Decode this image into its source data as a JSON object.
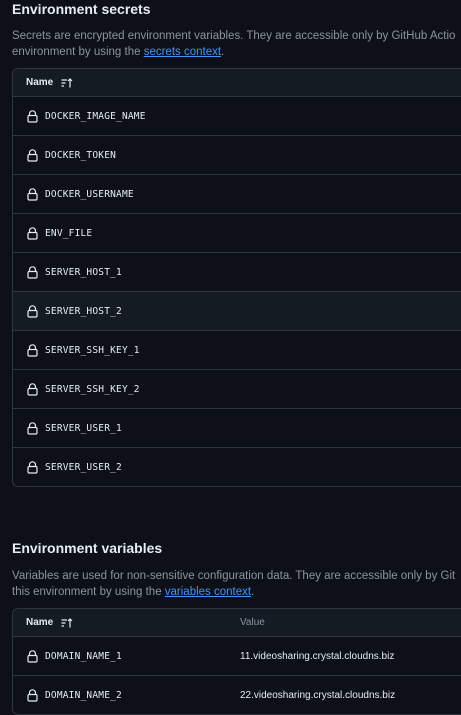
{
  "secrets": {
    "title": "Environment secrets",
    "desc_line1": "Secrets are encrypted environment variables. They are accessible only by GitHub Actio",
    "desc_line2_pre": "environment by using the ",
    "desc_link": "secrets context",
    "desc_line2_post": ".",
    "header_name": "Name",
    "rows": [
      "DOCKER_IMAGE_NAME",
      "DOCKER_TOKEN",
      "DOCKER_USERNAME",
      "ENV_FILE",
      "SERVER_HOST_1",
      "SERVER_HOST_2",
      "SERVER_SSH_KEY_1",
      "SERVER_SSH_KEY_2",
      "SERVER_USER_1",
      "SERVER_USER_2"
    ]
  },
  "variables": {
    "title": "Environment variables",
    "desc_line1": "Variables are used for non-sensitive configuration data. They are accessible only by Git",
    "desc_line2_pre": "this environment by using the ",
    "desc_link": "variables context",
    "desc_line2_post": ".",
    "header_name": "Name",
    "header_value": "Value",
    "rows": [
      {
        "name": "DOMAIN_NAME_1",
        "value": "11.videosharing.crystal.cloudns.biz"
      },
      {
        "name": "DOMAIN_NAME_2",
        "value": "22.videosharing.crystal.cloudns.biz"
      }
    ]
  },
  "colors": {
    "background": "#0d1117",
    "border": "#30363d",
    "link": "#4493f8",
    "muted": "#8b949e"
  },
  "icons": {
    "row_icon": "lock-icon",
    "sort_icon": "sort-ascending-icon"
  }
}
